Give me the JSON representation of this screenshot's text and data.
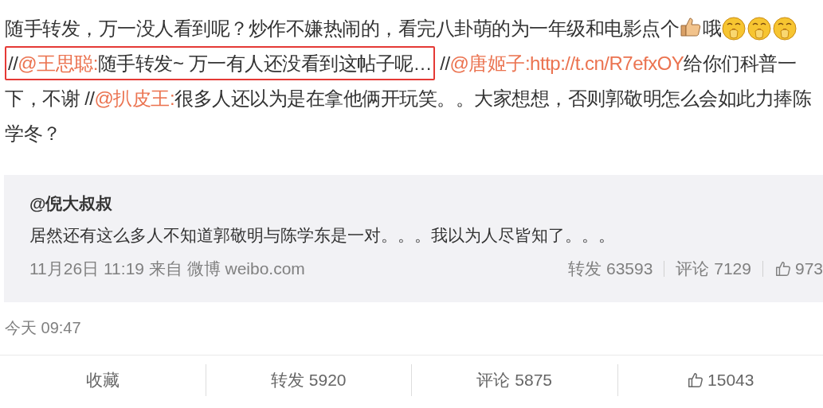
{
  "post": {
    "segments": [
      {
        "kind": "text",
        "text": "随手转发，万一没人看到呢？炒作不嫌热闹的，看完八卦萌的为一年级和电影点个"
      },
      {
        "kind": "thumb_emoji"
      },
      {
        "kind": "text",
        "text": "哦"
      },
      {
        "kind": "yawn_emoji"
      },
      {
        "kind": "yawn_emoji"
      },
      {
        "kind": "yawn_emoji"
      },
      {
        "kind": "boxed",
        "segments": [
          {
            "kind": "text",
            "text": "//"
          },
          {
            "kind": "link",
            "text": "@王思聪:"
          },
          {
            "kind": "text",
            "text": "随手转发~ 万一有人还没看到这帖子呢…"
          }
        ]
      },
      {
        "kind": "text",
        "text": " //"
      },
      {
        "kind": "link",
        "text": "@唐姬子:"
      },
      {
        "kind": "link",
        "text": "http://t.cn/R7efxOY"
      },
      {
        "kind": "text",
        "text": "给你们科普一下，不谢 //"
      },
      {
        "kind": "link",
        "text": "@扒皮王:"
      },
      {
        "kind": "text",
        "text": "很多人还以为是在拿他俩开玩笑。。大家想想，否则郭敬明怎么会如此力捧陈学冬？"
      }
    ]
  },
  "quoted": {
    "author": "@倪大叔叔",
    "text": "居然还有这么多人不知道郭敬明与陈学东是一对。。。我以为人尽皆知了。。。",
    "meta": "11月26日 11:19 来自 微博 weibo.com",
    "stats": [
      {
        "kind": "text",
        "text": "转发 63593"
      },
      {
        "kind": "text",
        "text": "评论 7129"
      },
      {
        "kind": "like",
        "text": "973"
      }
    ]
  },
  "time": "今天 09:47",
  "actions": [
    {
      "kind": "text",
      "text": "收藏"
    },
    {
      "kind": "text",
      "text": "转发 5920"
    },
    {
      "kind": "text",
      "text": "评论 5875"
    },
    {
      "kind": "like",
      "text": "15043"
    }
  ]
}
